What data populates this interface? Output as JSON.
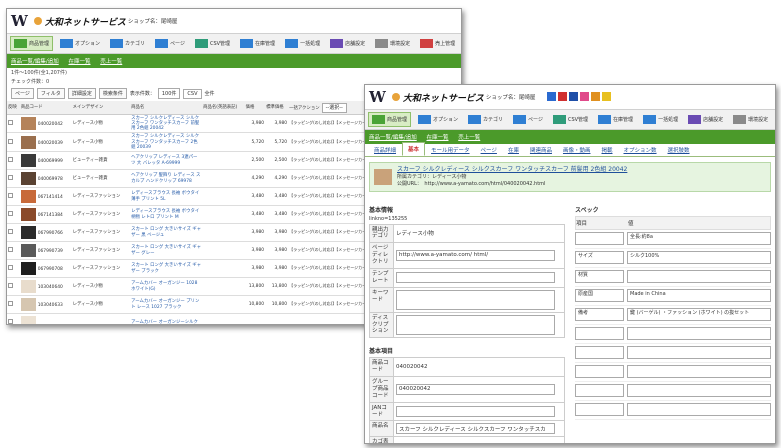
{
  "win1": {
    "header": {
      "logo": "W",
      "shop_name": "大和ネットサービス",
      "title_suffix": "ショップ名：尾崎屋"
    },
    "toolbar": [
      {
        "label": "商品管理",
        "color": "#4aa336",
        "active": true
      },
      {
        "label": "オプション",
        "color": "#2f7fd3"
      },
      {
        "label": "カテゴリ",
        "color": "#2f7fd3"
      },
      {
        "label": "ページ",
        "color": "#2f7fd3"
      },
      {
        "label": "CSV管理",
        "color": "#2f9c7a"
      },
      {
        "label": "在庫管理",
        "color": "#2f7fd3"
      },
      {
        "label": "一括処理",
        "color": "#2f7fd3"
      },
      {
        "label": "店舗設定",
        "color": "#6a4bb3"
      },
      {
        "label": "環境設定",
        "color": "#8a8a8a"
      },
      {
        "label": "売上管理",
        "color": "#d04040"
      }
    ],
    "subnav": [
      "商品一覧/編集/追加",
      "在庫一覧",
      "売上一覧"
    ],
    "count_line": "1件～100件(全1,207件)",
    "check_line": "チェック件数：0",
    "controls": {
      "page_btn": "ページ",
      "filter_btn": "フィルタ",
      "display_btn": "詳細設定",
      "search_btn": "検索条件",
      "display_count_label": "表示件数：",
      "display_count": "100件",
      "csv_label": "CSV",
      "all_label": "全件"
    },
    "columns": [
      "反映",
      "商品コード",
      "メインデザイン",
      "商品名",
      "商品名(英語表記)",
      "価格",
      "標準価格",
      "一括アクション",
      "ページリンク",
      "数値化",
      "更新日",
      "新着",
      "売上"
    ],
    "bulk_select": "--選択--",
    "rows": [
      {
        "code": "040020042",
        "cat": "レディース小物",
        "name": "スカーフ シルクレディース シルクスカーフ ワンタッチスカーフ 前髪用 2色組 20042",
        "price": "3,980",
        "list": "3,980",
        "act": "【ラッピング(のし対応)】【メッセージカード対応】"
      },
      {
        "code": "040020039",
        "cat": "レディース小物",
        "name": "スカーフ シルクレディース シルクスカーフ ワンタッチスカーフ 2色組 20039",
        "price": "5,720",
        "list": "5,720",
        "act": "【ラッピング(のし対応)】【メッセージカード対応】"
      },
      {
        "code": "040069999",
        "cat": "ビューティー雑貨",
        "name": "ヘアクリップ レディース 3連パーツ 大 バレッタ A-69999",
        "price": "2,500",
        "list": "2,500",
        "act": "【ラッピング(のし対応)】【メッセージカード対応】"
      },
      {
        "code": "040069978",
        "cat": "ビューティー雑貨",
        "name": "ヘアクリップ 髪飾り レディース スカルプ ハンドクリップ 69978",
        "price": "4,290",
        "list": "4,290",
        "act": "【ラッピング(のし対応)】【メッセージカード対応】"
      },
      {
        "code": "067141414",
        "cat": "レディースファッション",
        "name": "レディースブラウス 長袖 ボウタイ 薄手 プリント 5L",
        "price": "3,480",
        "list": "3,480",
        "act": "【ラッピング(のし対応)】【メッセージカード対応】"
      },
      {
        "code": "067141384",
        "cat": "レディースファッション",
        "name": "レディースブラウス 長袖 ボウタイ 柄物 レトロ プリント M",
        "price": "3,480",
        "list": "3,480",
        "act": "【ラッピング(のし対応)】【メッセージカード対応】"
      },
      {
        "code": "067990766",
        "cat": "レディースファッション",
        "name": "スカート ロング 大きいサイズ ギャザー 黒 ベージュ",
        "price": "3,980",
        "list": "3,980",
        "act": "【ラッピング(のし対応)】【メッセージカード対応】"
      },
      {
        "code": "067990739",
        "cat": "レディースファッション",
        "name": "スカート ロング 大きいサイズ ギャザー グレー",
        "price": "3,980",
        "list": "3,980",
        "act": "【ラッピング(のし対応)】【メッセージカード対応】"
      },
      {
        "code": "067990708",
        "cat": "レディースファッション",
        "name": "スカート ロング 大きいサイズ ギャザー ブラック",
        "price": "3,980",
        "list": "3,980",
        "act": "【ラッピング(のし対応)】【メッセージカード対応】"
      },
      {
        "code": "103040640",
        "cat": "レディース小物",
        "name": "アームカバー オーガンジー 1028 ホワイト(G)",
        "price": "13,800",
        "list": "13,800",
        "act": "【ラッピング(のし対応)】【メッセージカード対応】"
      },
      {
        "code": "103040633",
        "cat": "レディース小物",
        "name": "アームカバー オーガンジー プリント レース 1027 ブラック",
        "price": "10,800",
        "list": "10,800",
        "act": "【ラッピング(のし対応)】【メッセージカード対応】"
      },
      {
        "code": "",
        "cat": "",
        "name": "アームカバー オーガンジーシルク",
        "price": "",
        "list": "",
        "act": ""
      }
    ]
  },
  "win2": {
    "header": {
      "logo": "W",
      "shop_name": "大和ネットサービス",
      "title_suffix": "ショップ名：尾崎屋"
    },
    "subnav": [
      "商品一覧/編集/追加",
      "在庫一覧",
      "売上一覧"
    ],
    "tabs": [
      "商品詳細",
      "基本",
      "モール用データ",
      "ページ",
      "在庫",
      "関連商品",
      "画像・動画",
      "掲載",
      "オプション数",
      "選択肢数"
    ],
    "product_title": "スカーフ シルクレディース シルクスカーフ ワンタッチスカーフ 前髪用 2色組 20042",
    "category_line": "所属カテゴリ：レディース小物",
    "url_line": "公開URL：　http://www.a-yamato.com/html/040020042.html",
    "basic": {
      "heading": "基本情報",
      "link_id": "linkno=135255",
      "fields": [
        {
          "label": "親出力デゴリ",
          "value": "レディース小物",
          "type": "text"
        },
        {
          "label": "ページディレクトリ",
          "value": "http://www.a-yamato.com/ html/",
          "type": "input"
        },
        {
          "label": "テンプレート",
          "value": "",
          "type": "select"
        },
        {
          "label": "キーワード",
          "value": "",
          "type": "textarea"
        },
        {
          "label": "ディスクリプション",
          "value": "",
          "type": "textarea"
        }
      ]
    },
    "items": {
      "heading": "基本項目",
      "fields": [
        {
          "label": "商品コード",
          "value": "040020042",
          "type": "text"
        },
        {
          "label": "グループ商品コード",
          "value": "040020042",
          "type": "input"
        },
        {
          "label": "JANコード",
          "value": "",
          "type": "input"
        },
        {
          "label": "商品名",
          "value": "スカーフ シルクレディース シルクスカーフ ワンタッチスカ",
          "type": "input"
        },
        {
          "label": "カゴ表記商品名",
          "value": "ワンタッチスカーフ 前髪用 2色組 20042",
          "type": "input"
        }
      ]
    },
    "spec": {
      "heading": "スペック",
      "col_key": "項目",
      "col_val": "値",
      "rows": [
        {
          "k": "",
          "v": "全長:約8a"
        },
        {
          "k": "サイズ",
          "v": "シルク100%"
        },
        {
          "k": "材質",
          "v": ""
        },
        {
          "k": "原産国",
          "v": "Made in China"
        },
        {
          "k": "備考",
          "v": "鍵 (バーゲル) ・ファッション (ホワイト) の抜セット"
        },
        {
          "k": "",
          "v": ""
        },
        {
          "k": "",
          "v": ""
        },
        {
          "k": "",
          "v": ""
        },
        {
          "k": "",
          "v": ""
        },
        {
          "k": "",
          "v": ""
        }
      ]
    }
  }
}
